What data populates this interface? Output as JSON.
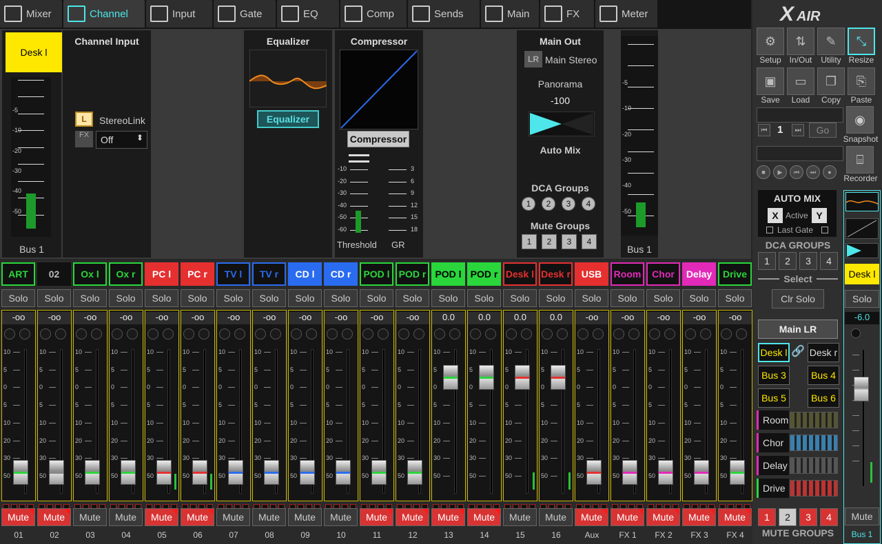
{
  "tabs": [
    {
      "label": "Mixer",
      "icon": "mixer-icon"
    },
    {
      "label": "Channel",
      "icon": "channel-icon",
      "active": true
    },
    {
      "label": "Input",
      "icon": "input-icon"
    },
    {
      "label": "Gate",
      "icon": "gate-icon"
    },
    {
      "label": "EQ",
      "icon": "eq-icon"
    },
    {
      "label": "Comp",
      "icon": "comp-icon"
    },
    {
      "label": "Sends",
      "icon": "sends-icon"
    },
    {
      "label": "Main",
      "icon": "main-icon"
    },
    {
      "label": "FX",
      "icon": "fx-icon"
    },
    {
      "label": "Meter",
      "icon": "meter-icon"
    }
  ],
  "channel_panel": {
    "name": "Desk l",
    "input_title": "Channel Input",
    "link_btn": "L",
    "stereolink_label": "StereoLink",
    "fx_btn": "FX",
    "fx_select": "Off",
    "eq_title": "Equalizer",
    "eq_button": "Equalizer",
    "comp_title": "Compressor",
    "comp_button": "Compressor",
    "threshold_label": "Threshold",
    "gr_label": "GR",
    "bus_label": "Bus 1",
    "main_out_title": "Main Out",
    "main_stereo_badge": "LR",
    "main_stereo": "Main Stereo",
    "panorama_label": "Panorama",
    "panorama_value": "-100",
    "auto_mix_label": "Auto Mix",
    "dca_groups_label": "DCA Groups",
    "dca_groups": [
      "1",
      "2",
      "3",
      "4"
    ],
    "mute_groups_label": "Mute Groups",
    "mute_groups": [
      "1",
      "2",
      "3",
      "4"
    ],
    "bus_label2": "Bus 1"
  },
  "meter_scale": [
    "-5",
    "-10",
    "-20",
    "-30",
    "-40",
    "-50"
  ],
  "comp_scale_left": [
    "-10",
    "-20",
    "-30",
    "-40",
    "-50",
    "-60"
  ],
  "comp_scale_right": [
    "3",
    "6",
    "9",
    "12",
    "15",
    "18"
  ],
  "fader_scale": [
    "10",
    "5",
    "0",
    "5",
    "10",
    "20",
    "30",
    "50"
  ],
  "solo_label": "Solo",
  "mute_label": "Mute",
  "channels": [
    {
      "name": "ART",
      "color": "#2ad63b",
      "bg": "#111",
      "fg": "#2ad63b",
      "value": "-oo",
      "fader": 0.06,
      "line": "#2ad63b",
      "mute": true,
      "num": "01",
      "meter": 0
    },
    {
      "name": "02",
      "color": "#111",
      "bg": "#111",
      "fg": "#bbb",
      "value": "-oo",
      "fader": 0.06,
      "line": "#888",
      "mute": true,
      "num": "02",
      "meter": 0
    },
    {
      "name": "Ox l",
      "color": "#2ad63b",
      "bg": "#111",
      "fg": "#2ad63b",
      "value": "-oo",
      "fader": 0.06,
      "line": "#2ad63b",
      "mute": false,
      "num": "03",
      "meter": 0
    },
    {
      "name": "Ox r",
      "color": "#2ad63b",
      "bg": "#111",
      "fg": "#2ad63b",
      "value": "-oo",
      "fader": 0.06,
      "line": "#2ad63b",
      "mute": false,
      "num": "04",
      "meter": 0
    },
    {
      "name": "PC l",
      "color": "#e63030",
      "bg": "#e63030",
      "fg": "#fff",
      "value": "-oo",
      "fader": 0.06,
      "line": "#e63030",
      "mute": true,
      "num": "05",
      "meter": 0.14
    },
    {
      "name": "PC r",
      "color": "#e63030",
      "bg": "#e63030",
      "fg": "#fff",
      "value": "-oo",
      "fader": 0.06,
      "line": "#e63030",
      "mute": true,
      "num": "06",
      "meter": 0.14
    },
    {
      "name": "TV l",
      "color": "#2a6cf0",
      "bg": "#111",
      "fg": "#2a6cf0",
      "value": "-oo",
      "fader": 0.06,
      "line": "#2a6cf0",
      "mute": false,
      "num": "07",
      "meter": 0
    },
    {
      "name": "TV r",
      "color": "#2a6cf0",
      "bg": "#111",
      "fg": "#2a6cf0",
      "value": "-oo",
      "fader": 0.06,
      "line": "#2a6cf0",
      "mute": false,
      "num": "08",
      "meter": 0
    },
    {
      "name": "CD l",
      "color": "#2a6cf0",
      "bg": "#2a6cf0",
      "fg": "#fff",
      "value": "-oo",
      "fader": 0.06,
      "line": "#2a6cf0",
      "mute": false,
      "num": "09",
      "meter": 0
    },
    {
      "name": "CD r",
      "color": "#2a6cf0",
      "bg": "#2a6cf0",
      "fg": "#fff",
      "value": "-oo",
      "fader": 0.06,
      "line": "#2a6cf0",
      "mute": false,
      "num": "10",
      "meter": 0
    },
    {
      "name": "POD l",
      "color": "#2ad63b",
      "bg": "#111",
      "fg": "#2ad63b",
      "value": "-oo",
      "fader": 0.06,
      "line": "#2ad63b",
      "mute": true,
      "num": "11",
      "meter": 0
    },
    {
      "name": "POD r",
      "color": "#2ad63b",
      "bg": "#111",
      "fg": "#2ad63b",
      "value": "-oo",
      "fader": 0.06,
      "line": "#2ad63b",
      "mute": true,
      "num": "12",
      "meter": 0
    },
    {
      "name": "POD l",
      "color": "#2ad63b",
      "bg": "#2ad63b",
      "fg": "#000",
      "value": "0.0",
      "fader": 0.72,
      "line": "#2ad63b",
      "mute": true,
      "num": "13",
      "meter": 0
    },
    {
      "name": "POD r",
      "color": "#2ad63b",
      "bg": "#2ad63b",
      "fg": "#000",
      "value": "0.0",
      "fader": 0.72,
      "line": "#2ad63b",
      "mute": true,
      "num": "14",
      "meter": 0
    },
    {
      "name": "Desk l",
      "color": "#e63030",
      "bg": "#111",
      "fg": "#e63030",
      "value": "0.0",
      "fader": 0.72,
      "line": "#e63030",
      "mute": false,
      "num": "15",
      "meter": 0.15
    },
    {
      "name": "Desk r",
      "color": "#e63030",
      "bg": "#111",
      "fg": "#e63030",
      "value": "0.0",
      "fader": 0.72,
      "line": "#e63030",
      "mute": false,
      "num": "16",
      "meter": 0.15
    },
    {
      "name": "USB",
      "color": "#e63030",
      "bg": "#e63030",
      "fg": "#fff",
      "value": "-oo",
      "fader": 0.06,
      "line": "#e63030",
      "mute": true,
      "num": "Aux",
      "meter": 0
    },
    {
      "name": "Room",
      "color": "#e22ab8",
      "bg": "#111",
      "fg": "#e22ab8",
      "value": "-oo",
      "fader": 0.06,
      "line": "#e22ab8",
      "mute": true,
      "num": "FX 1",
      "meter": 0
    },
    {
      "name": "Chor",
      "color": "#e22ab8",
      "bg": "#111",
      "fg": "#e22ab8",
      "value": "-oo",
      "fader": 0.06,
      "line": "#e22ab8",
      "mute": true,
      "num": "FX 2",
      "meter": 0
    },
    {
      "name": "Delay",
      "color": "#e22ab8",
      "bg": "#e22ab8",
      "fg": "#fff",
      "value": "-oo",
      "fader": 0.06,
      "line": "#e22ab8",
      "mute": true,
      "num": "FX 3",
      "meter": 0
    },
    {
      "name": "Drive",
      "color": "#2ad63b",
      "bg": "#111",
      "fg": "#2ad63b",
      "value": "-oo",
      "fader": 0.06,
      "line": "#2ad63b",
      "mute": true,
      "num": "FX 4",
      "meter": 0
    }
  ],
  "right": {
    "brand_x": "X",
    "brand": "AIR",
    "setup": "Setup",
    "inout": "In/Out",
    "utility": "Utility",
    "resize": "Resize",
    "save": "Save",
    "load": "Load",
    "copy": "Copy",
    "paste": "Paste",
    "snap_num": "1",
    "go": "Go",
    "snapshot": "Snapshot",
    "recorder": "Recorder",
    "automix_title": "AUTO MIX",
    "automix_x": "X",
    "automix_active": "Active",
    "automix_y": "Y",
    "last_gate": "Last Gate",
    "dca_title": "DCA GROUPS",
    "dca": [
      "1",
      "2",
      "3",
      "4"
    ],
    "select_title": "Select",
    "clr_solo": "Clr Solo",
    "main_lr": "Main LR",
    "bus_buttons": [
      "Desk l",
      "Desk r",
      "Bus 3",
      "Bus 4",
      "Bus 5",
      "Bus 6"
    ],
    "fx_buttons": [
      "Room",
      "Chor",
      "Delay",
      "Drive"
    ],
    "mute_groups_title": "MUTE GROUPS",
    "mute_groups": [
      "1",
      "2",
      "3",
      "4"
    ],
    "sel_name": "Desk l",
    "sel_solo": "Solo",
    "sel_value": "-6.0",
    "sel_mute": "Mute",
    "sel_bus": "Bus 1",
    "sel_fader": 0.62,
    "sel_meter": 0.18
  }
}
